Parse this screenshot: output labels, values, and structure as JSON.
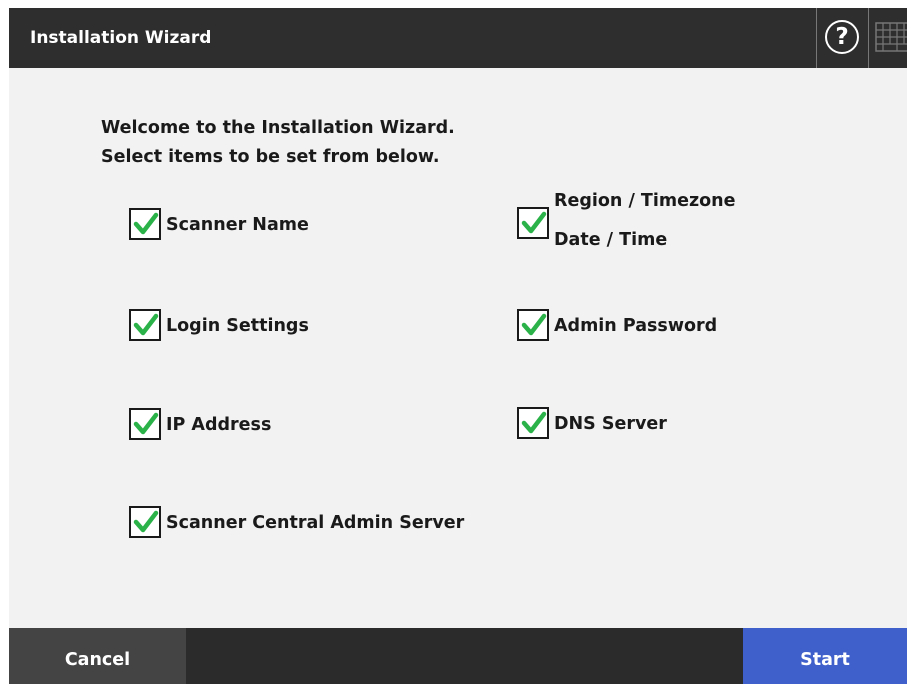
{
  "window": {
    "title": "Installation Wizard"
  },
  "toolbar": {
    "help_label": "?"
  },
  "intro": {
    "line1": "Welcome to the Installation Wizard.",
    "line2": "Select items to be set from below."
  },
  "options": {
    "scanner_name": {
      "label": "Scanner Name",
      "checked": true
    },
    "region_timezone": {
      "label1": "Region / Timezone",
      "label2": "Date / Time",
      "checked": true
    },
    "login_settings": {
      "label": "Login Settings",
      "checked": true
    },
    "admin_password": {
      "label": "Admin Password",
      "checked": true
    },
    "ip_address": {
      "label": "IP Address",
      "checked": true
    },
    "dns_server": {
      "label": "DNS Server",
      "checked": true
    },
    "central_admin": {
      "label": "Scanner Central Admin Server",
      "checked": true
    }
  },
  "footer": {
    "cancel_label": "Cancel",
    "start_label": "Start"
  },
  "colors": {
    "titlebar": "#2e2e2e",
    "content_bg": "#f2f2f2",
    "check_green": "#2bb34a",
    "start_button": "#3f5fca",
    "cancel_button": "#444444"
  }
}
